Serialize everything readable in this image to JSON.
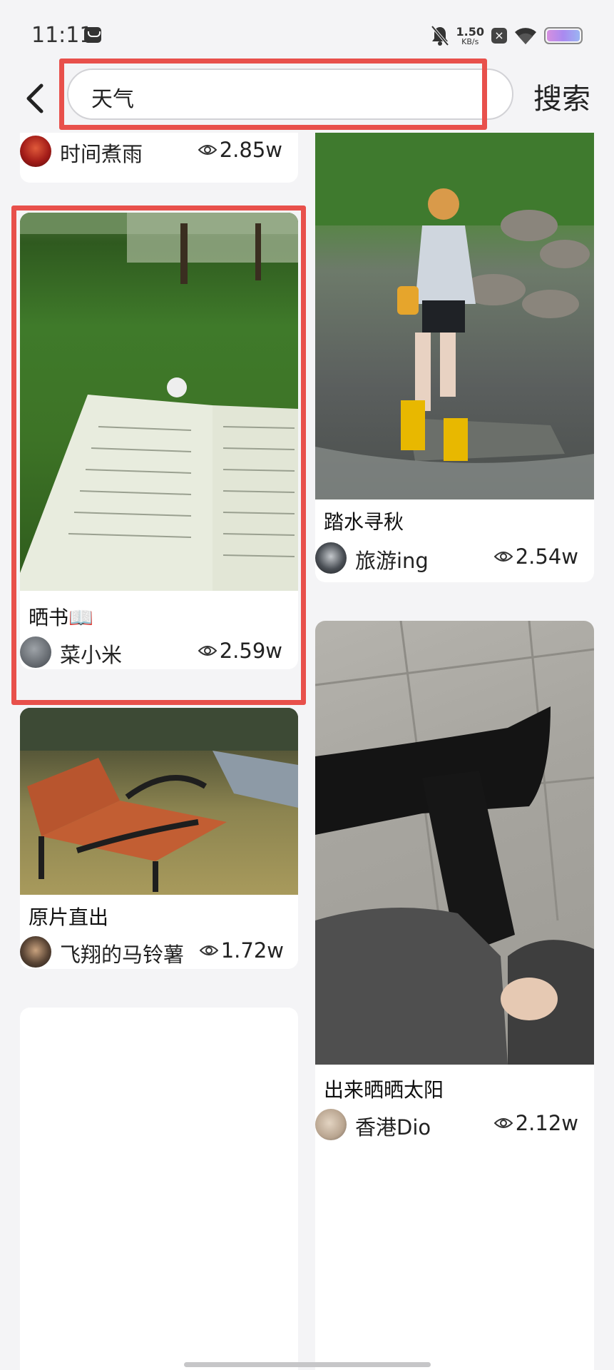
{
  "status_bar": {
    "time": "11:11",
    "net_speed_value": "1.50",
    "net_speed_unit": "KB/s",
    "battery_level": 1.0
  },
  "header": {
    "back_icon": "chevron-left-icon",
    "search_value": "天气",
    "search_button_label": "搜索"
  },
  "colors": {
    "highlight": "#e8504b",
    "background": "#f4f4f6",
    "card": "#ffffff"
  },
  "feed": {
    "left_column": [
      {
        "title": "",
        "author": "时间煮雨",
        "views": "2.85w",
        "image": "partial-cover-photo",
        "avatar": "red-avatar"
      },
      {
        "title": "晒书📖",
        "author": "菜小米",
        "views": "2.59w",
        "image": "open-book-on-grass-photo",
        "avatar": "gray-avatar",
        "selected": true
      },
      {
        "title": "原片直出",
        "author": "飞翔的马铃薯",
        "views": "1.72w",
        "image": "park-bench-photo",
        "avatar": "portrait-avatar"
      },
      {
        "title": "",
        "author": "",
        "views": "",
        "image": "loading-placeholder"
      }
    ],
    "right_column": [
      {
        "title": "踏水寻秋",
        "author": "旅游ing",
        "views": "2.54w",
        "image": "girl-crossing-stream-photo",
        "avatar": "dark-avatar"
      },
      {
        "title": "出来晒晒太阳",
        "author": "香港Dio",
        "views": "2.12w",
        "image": "black-tights-crossed-legs-photo",
        "avatar": "beige-avatar"
      },
      {
        "title": "",
        "author": "",
        "views": "",
        "image": "loading-placeholder"
      }
    ]
  }
}
